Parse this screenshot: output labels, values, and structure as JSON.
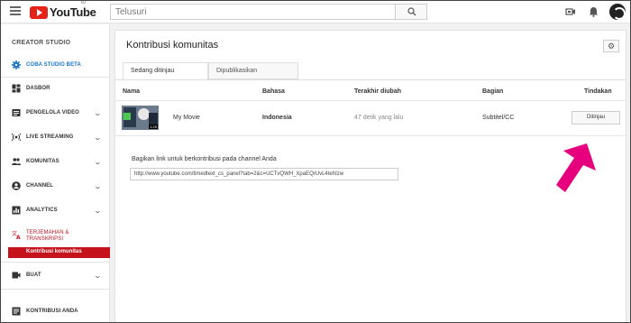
{
  "header": {
    "logo_text": "YouTube",
    "logo_sup": "ID",
    "search_placeholder": "Telusuri",
    "icons": [
      "menu-icon",
      "search-icon",
      "video-camera-icon",
      "bell-icon",
      "avatar"
    ]
  },
  "sidebar": {
    "title": "CREATOR STUDIO",
    "items": [
      {
        "label": "COBA STUDIO BETA",
        "icon": "gear-icon",
        "accent": true
      },
      {
        "label": "DASBOR",
        "icon": "dashboard-icon"
      },
      {
        "label": "PENGELOLA VIDEO",
        "icon": "video-manager-icon",
        "chevron": true
      },
      {
        "label": "LIVE STREAMING",
        "icon": "live-icon",
        "chevron": true
      },
      {
        "label": "KOMUNITAS",
        "icon": "people-icon",
        "chevron": true
      },
      {
        "label": "CHANNEL",
        "icon": "person-icon",
        "chevron": true
      },
      {
        "label": "ANALYTICS",
        "icon": "chart-icon",
        "chevron": true
      },
      {
        "label": "TERJEMAHAN &",
        "label2": "TRANSKRIPSI",
        "icon": "translate-icon",
        "accent": true
      },
      {
        "label": "BUAT",
        "icon": "create-icon",
        "chevron": true
      },
      {
        "label": "KONTRIBUSI ANDA",
        "icon": "contribute-icon"
      }
    ],
    "active_sub": "Kontribusi komunitas"
  },
  "main": {
    "title": "Kontribusi komunitas",
    "tabs": [
      {
        "label": "Sedang ditinjau"
      },
      {
        "label": "Dipublikasikan"
      }
    ],
    "columns": [
      "Nama",
      "Bahasa",
      "Terakhir diubah",
      "Bagian",
      "Tindakan"
    ],
    "rows": [
      {
        "name": "My Movie",
        "thumb_time": "1:25",
        "language": "Indonesia",
        "modified": "47 detik yang lalu",
        "section": "Subtitel/CC",
        "action": "Ditinjau"
      }
    ],
    "share_label": "Bagikan link untuk berkontribusi pada channel Anda",
    "share_url": "http://www.youtube.com/timedtext_cs_panel?tab=2&c=UCTvQWH_XpaEQrUvL4tehIzw"
  },
  "colors": {
    "accent_red": "#c5121d",
    "accent_blue": "#1a73c8",
    "arrow_pink": "#e6007e"
  }
}
